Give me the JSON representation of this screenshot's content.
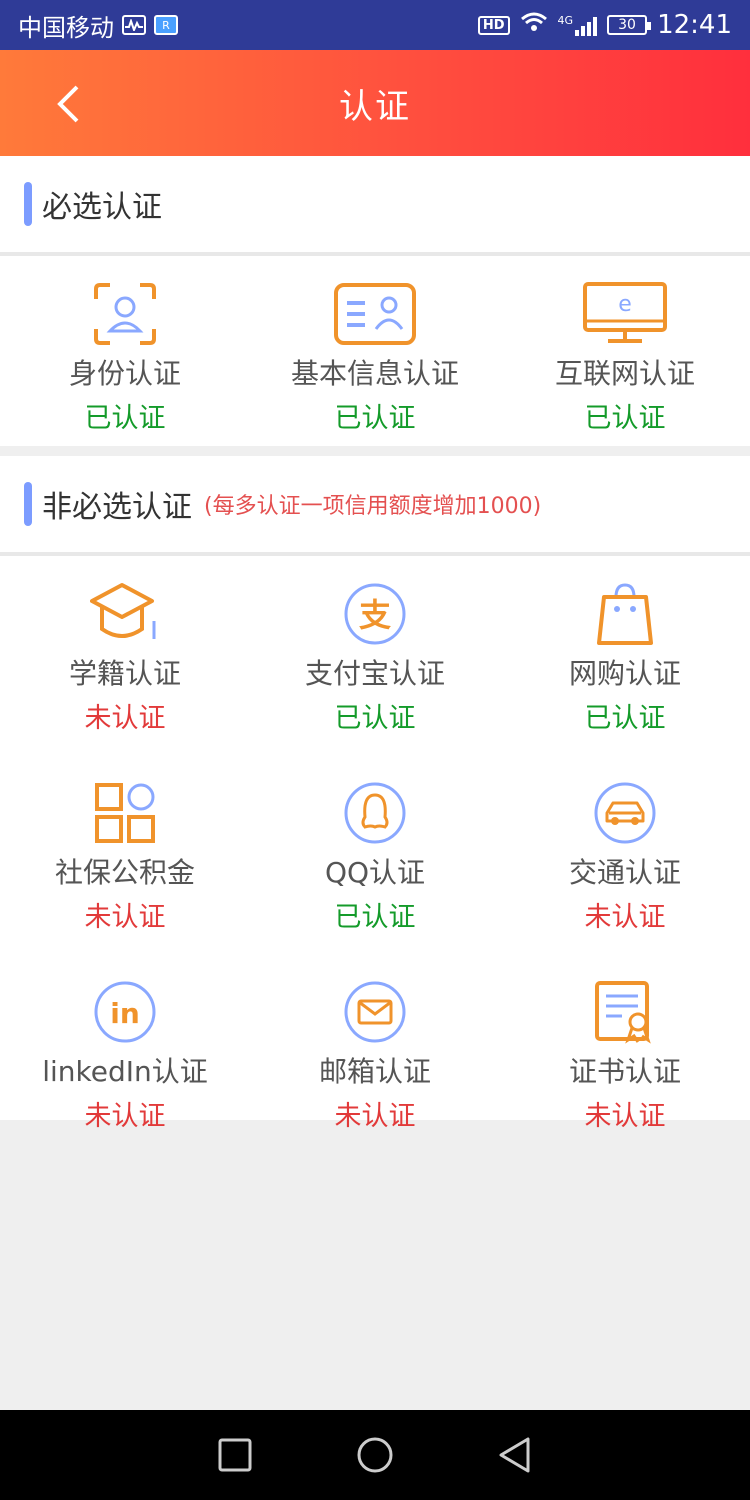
{
  "status_bar": {
    "carrier": "中国移动",
    "network": "4G",
    "battery": "30",
    "time": "12:41",
    "hd_label": "HD"
  },
  "header": {
    "title": "认证",
    "back_icon": "chevron-left-icon"
  },
  "colors": {
    "header_gradient_start": "#ff7a3a",
    "header_gradient_end": "#ff2f3d",
    "accent_bar": "#7c9cff",
    "icon_orange": "#f0932b",
    "icon_blue": "#8aa8ff",
    "status_done": "#149b2a",
    "status_pending": "#e23a3a"
  },
  "required_section": {
    "label": "必选认证",
    "items": [
      {
        "name": "身份认证",
        "status": "已认证",
        "icon": "id-scan-icon"
      },
      {
        "name": "基本信息认证",
        "status": "已认证",
        "icon": "id-card-icon"
      },
      {
        "name": "互联网认证",
        "status": "已认证",
        "icon": "monitor-icon"
      }
    ]
  },
  "optional_section": {
    "label": "非必选认证",
    "note": "(每多认证一项信用额度增加1000)",
    "items": [
      {
        "name": "学籍认证",
        "status": "未认证",
        "icon": "graduation-cap-icon"
      },
      {
        "name": "支付宝认证",
        "status": "已认证",
        "icon": "alipay-icon"
      },
      {
        "name": "网购认证",
        "status": "已认证",
        "icon": "shopping-bag-icon"
      },
      {
        "name": "社保公积金",
        "status": "未认证",
        "icon": "grid-apps-icon"
      },
      {
        "name": "QQ认证",
        "status": "已认证",
        "icon": "qq-icon"
      },
      {
        "name": "交通认证",
        "status": "未认证",
        "icon": "car-icon"
      },
      {
        "name": "linkedIn认证",
        "status": "未认证",
        "icon": "linkedin-icon"
      },
      {
        "name": "邮箱认证",
        "status": "未认证",
        "icon": "mail-icon"
      },
      {
        "name": "证书认证",
        "status": "未认证",
        "icon": "certificate-icon"
      }
    ]
  },
  "nav_bar": {
    "recent_icon": "square-icon",
    "home_icon": "circle-icon",
    "back_icon": "triangle-back-icon"
  }
}
